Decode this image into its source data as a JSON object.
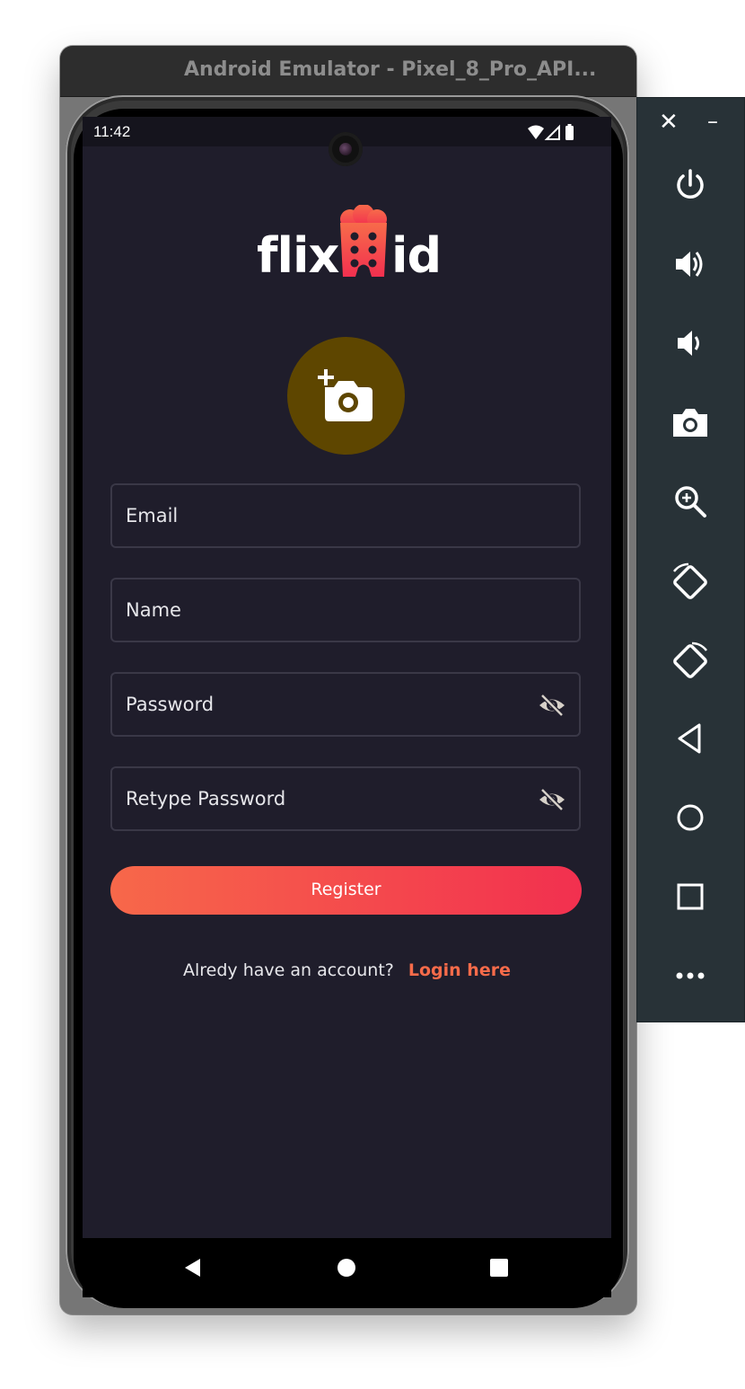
{
  "emulator": {
    "window_title": "Android Emulator - Pixel_8_Pro_API...",
    "toolbar": {
      "close_label": "✕",
      "minimize_label": "–",
      "buttons": [
        "power-icon",
        "volume-up-icon",
        "volume-down-icon",
        "screenshot-icon",
        "zoom-icon",
        "rotate-left-icon",
        "rotate-right-icon",
        "back-icon",
        "home-icon",
        "overview-icon",
        "more-icon"
      ]
    }
  },
  "status_bar": {
    "time": "11:42",
    "icons": [
      "wifi-icon",
      "signal-icon",
      "battery-icon"
    ]
  },
  "app": {
    "logo": {
      "left_text": "flix",
      "right_text": "id"
    },
    "avatar": {
      "icon": "add-photo-icon",
      "bg_color": "#5e4600"
    },
    "fields": {
      "email_label": "Email",
      "name_label": "Name",
      "password_label": "Password",
      "retype_password_label": "Retype Password"
    },
    "register_label": "Register",
    "login_prompt": "Alredy have an account?",
    "login_link": "Login here",
    "colors": {
      "background": "#1f1d2b",
      "accent_start": "#f7684a",
      "accent_end": "#f2304f",
      "link": "#f76b4a"
    }
  },
  "nav_bar": {
    "buttons": [
      "nav-back-icon",
      "nav-home-icon",
      "nav-recents-icon"
    ]
  }
}
